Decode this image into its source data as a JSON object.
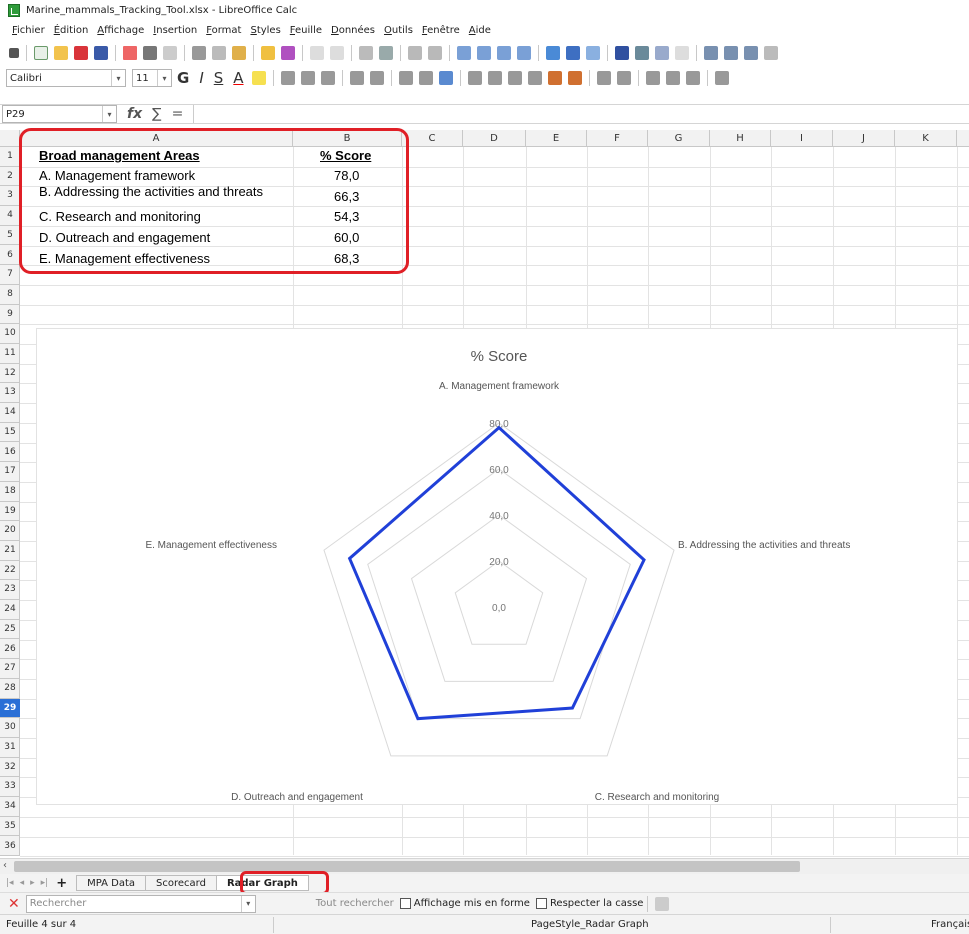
{
  "window": {
    "title": "Marine_mammals_Tracking_Tool.xlsx - LibreOffice Calc"
  },
  "menu": [
    "Fichier",
    "Édition",
    "Affichage",
    "Insertion",
    "Format",
    "Styles",
    "Feuille",
    "Données",
    "Outils",
    "Fenêtre",
    "Aide"
  ],
  "format_bar": {
    "font_name": "Calibri",
    "font_size": "11",
    "bold": "G",
    "italic": "I",
    "underline": "S",
    "font_color": "A"
  },
  "formula_bar": {
    "cell_ref": "P29",
    "fx": "fx",
    "sum": "∑",
    "equals": "="
  },
  "columns": [
    "A",
    "B",
    "C",
    "D",
    "E",
    "F",
    "G",
    "H",
    "I",
    "J",
    "K"
  ],
  "rows": [
    "1",
    "2",
    "3",
    "4",
    "5",
    "6",
    "7",
    "8",
    "9",
    "10",
    "11",
    "12",
    "13",
    "14",
    "15",
    "16",
    "17",
    "18",
    "19",
    "20",
    "21",
    "22",
    "23",
    "24",
    "25",
    "26",
    "27",
    "28",
    "29",
    "30",
    "31",
    "32",
    "33",
    "34",
    "35",
    "36"
  ],
  "table": {
    "header_area": "Broad management Areas",
    "header_score": "% Score",
    "rows": [
      {
        "area": "A. Management framework",
        "score": "78,0"
      },
      {
        "area": "B. Addressing the activities and threats",
        "score": "66,3"
      },
      {
        "area": "C. Research and monitoring",
        "score": "54,3"
      },
      {
        "area": "D. Outreach and engagement",
        "score": "60,0"
      },
      {
        "area": "E. Management effectiveness",
        "score": "68,3"
      }
    ]
  },
  "chart_data": {
    "type": "radar",
    "title": "% Score",
    "categories": [
      "A. Management framework",
      "B. Addressing the activities and threats",
      "C. Research and monitoring",
      "D. Outreach and engagement",
      "E. Management effectiveness"
    ],
    "series": [
      {
        "values": [
          78.0,
          66.3,
          54.3,
          60.0,
          68.3
        ],
        "color": "#2040d8"
      }
    ],
    "rlim": [
      0,
      80
    ],
    "ticks": [
      "0,0",
      "20,0",
      "40,0",
      "60,0",
      "80,0"
    ],
    "grid": true
  },
  "sheet_tabs": [
    {
      "label": "MPA Data",
      "active": false
    },
    {
      "label": "Scorecard",
      "active": false
    },
    {
      "label": "Radar Graph",
      "active": true
    }
  ],
  "findbar": {
    "placeholder": "Rechercher",
    "find_all": "Tout rechercher",
    "formatted": "Affichage mis en forme",
    "match_case": "Respecter la casse"
  },
  "status": {
    "sheet": "Feuille 4 sur 4",
    "page_style": "PageStyle_Radar Graph",
    "language": "Français"
  },
  "colors": {
    "highlight": "#e01f26",
    "selected_row": "#2a6fd6",
    "series": "#2040d8"
  }
}
